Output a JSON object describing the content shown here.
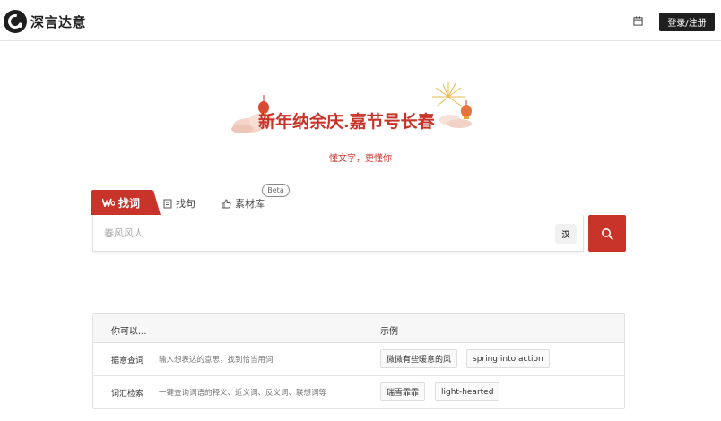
{
  "header": {
    "brand": "深言达意",
    "login_label": "登录/注册"
  },
  "banner": {
    "title": "新年纳余庆.嘉节号长春",
    "subtitle": "懂文字，更懂你"
  },
  "tabs": [
    {
      "label": "找词",
      "icon": "wo-logo-icon",
      "active": true
    },
    {
      "label": "找句",
      "icon": "bookmark-icon"
    },
    {
      "label": "素材库",
      "icon": "thumbs-up-icon",
      "badge": "Beta"
    }
  ],
  "search": {
    "placeholder": "春风风人",
    "lang_toggle": "汉"
  },
  "examples": {
    "col_you_can": "你可以...",
    "col_examples": "示例",
    "rows": [
      {
        "name": "据意查词",
        "desc": "输入想表达的意思，找到恰当用词",
        "chips": [
          "微微有些暖意的风",
          "spring into action"
        ]
      },
      {
        "name": "词汇检索",
        "desc": "一键查询词语的释义、近义词、反义词、联想词等",
        "chips": [
          "瑞雪霏霏",
          "light-hearted"
        ]
      }
    ]
  },
  "colors": {
    "accent": "#c8342a",
    "dark": "#1f1f1f"
  }
}
